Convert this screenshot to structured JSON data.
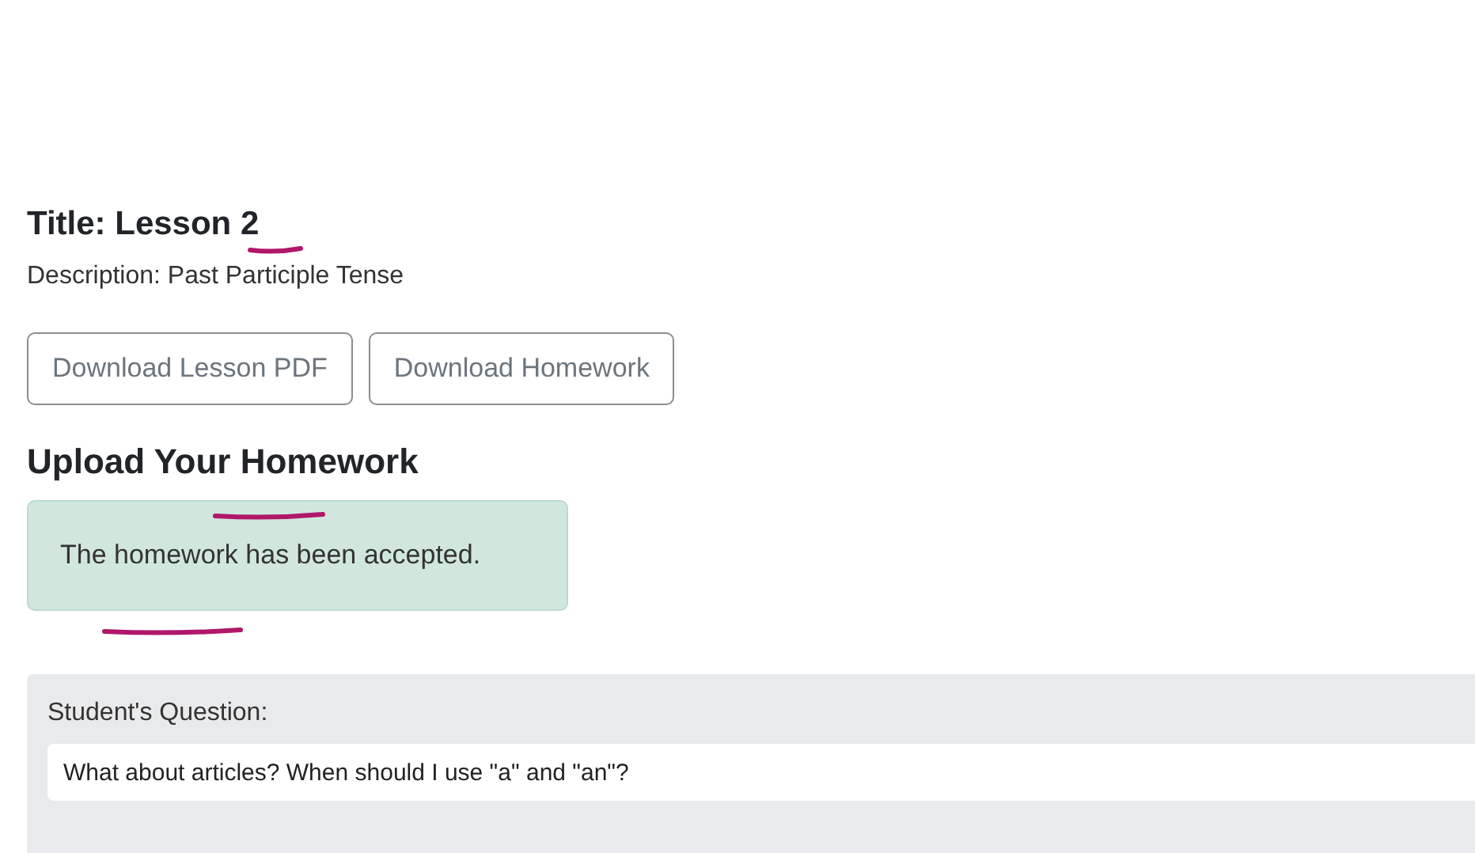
{
  "lesson": {
    "title": "Title: Lesson 2",
    "description": "Description: Past Participle Tense"
  },
  "buttons": [
    "Download Lesson PDF",
    "Download Homework"
  ],
  "upload": {
    "heading": "Upload Your Homework",
    "alert": "The homework has been accepted."
  },
  "question": {
    "label": "Student's Question:",
    "value": "What about articles? When should I use \"a\" and \"an\"?"
  }
}
